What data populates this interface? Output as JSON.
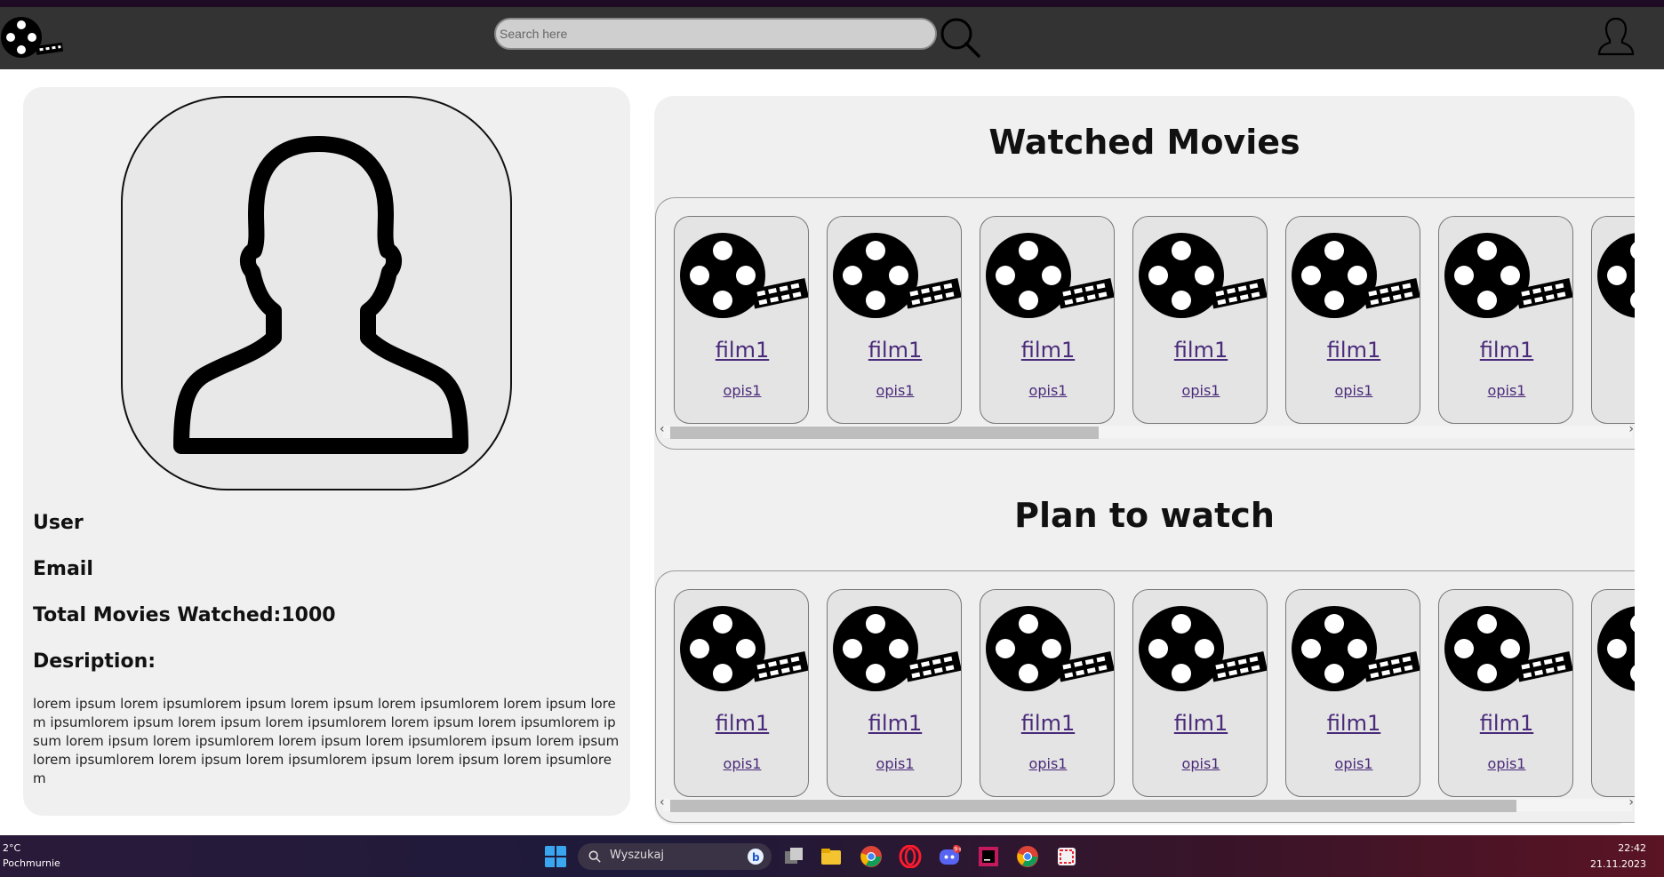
{
  "navbar": {
    "logo_icon": "film-reel-icon",
    "search_placeholder": "Search here",
    "search_icon": "magnifier-icon",
    "profile_icon": "user-icon"
  },
  "profile": {
    "avatar_icon": "user-silhouette-icon",
    "username": "User",
    "email": "Email",
    "total_movies_watched": "Total Movies Watched:1000",
    "description_label": "Desription:",
    "description": "lorem ipsum lorem ipsumlorem ipsum lorem ipsum lorem ipsumlorem lorem ipsum lorem ipsumlorem ipsum lorem ipsum lorem ipsumlorem lorem ipsum lorem ipsumlorem ipsum lorem ipsum lorem ipsumlorem lorem ipsum lorem ipsumlorem ipsum lorem ipsum lorem ipsumlorem lorem ipsum lorem ipsumlorem ipsum lorem ipsum lorem ipsumlorem"
  },
  "sections": [
    {
      "title": "Watched Movies",
      "movies": [
        {
          "title": "film1",
          "desc": "opis1"
        },
        {
          "title": "film1",
          "desc": "opis1"
        },
        {
          "title": "film1",
          "desc": "opis1"
        },
        {
          "title": "film1",
          "desc": "opis1"
        },
        {
          "title": "film1",
          "desc": "opis1"
        },
        {
          "title": "film1",
          "desc": "opis1"
        },
        {
          "title": "f",
          "desc": ""
        }
      ],
      "scroll_position": 0.45
    },
    {
      "title": "Plan to watch",
      "movies": [
        {
          "title": "film1",
          "desc": "opis1"
        },
        {
          "title": "film1",
          "desc": "opis1"
        },
        {
          "title": "film1",
          "desc": "opis1"
        },
        {
          "title": "film1",
          "desc": "opis1"
        },
        {
          "title": "film1",
          "desc": "opis1"
        },
        {
          "title": "film1",
          "desc": "opis1"
        },
        {
          "title": "f",
          "desc": ""
        }
      ],
      "scroll_position": 0.89
    }
  ],
  "taskbar": {
    "weather_temp": "2°C",
    "weather_desc": "Pochmurnie",
    "search_label": "Wyszukaj",
    "time": "22:42",
    "date": "21.11.2023",
    "discord_badge": "9+"
  },
  "colors": {
    "navbar": "#333333",
    "panel": "#f0f0f0",
    "link": "#4a2a7a"
  }
}
